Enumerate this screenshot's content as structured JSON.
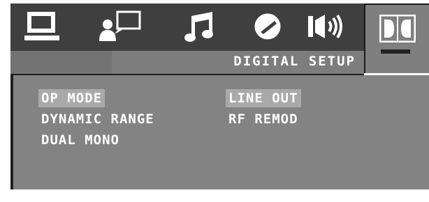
{
  "header": {
    "tabs": [
      {
        "name": "system",
        "icon": "monitor-icon"
      },
      {
        "name": "language",
        "icon": "person-speech-icon"
      },
      {
        "name": "audio",
        "icon": "music-note-icon"
      },
      {
        "name": "video",
        "icon": "contrast-knob-icon"
      },
      {
        "name": "speaker",
        "icon": "speaker-icon"
      },
      {
        "name": "digital",
        "icon": "dolby-dd-icon",
        "active": true
      }
    ],
    "page_title": "DIGITAL SETUP"
  },
  "menu": {
    "left": [
      {
        "label": "OP MODE",
        "highlighted": true
      },
      {
        "label": "DYNAMIC RANGE",
        "highlighted": false
      },
      {
        "label": "DUAL MONO",
        "highlighted": false
      }
    ],
    "right": [
      {
        "label": "LINE OUT",
        "highlighted": true
      },
      {
        "label": "RF REMOD",
        "highlighted": false
      }
    ]
  },
  "colors": {
    "topbar": "#3f3f3f",
    "panel": "#838383",
    "highlight": "#a9a9a9",
    "text": "#ffffff"
  }
}
